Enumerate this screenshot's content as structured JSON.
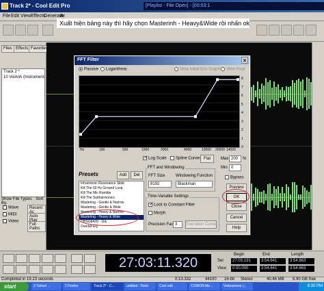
{
  "window": {
    "title": "Track 2* - Cool Edit Pro",
    "title_strip": "[Playlist - File Open] - [00:03:1"
  },
  "menu": [
    "File",
    "Edit",
    "View",
    "Effects",
    "Generate",
    "Ar"
  ],
  "annotation": "Xuất hiện bảng này thì hãy chọn Masterinh - Heavy&Wide rồi nhấn ok",
  "left_panel": {
    "tabs": [
      "Files",
      "Effects",
      "Favorites"
    ],
    "files": [
      "Track 2 *",
      "10 VoiAnh (Instrumental) -"
    ],
    "show_file_types": "Show File Types:",
    "sort_by": "Sort By:",
    "types": [
      "Wave",
      "MIDI",
      "Video"
    ],
    "sort_value": "Recent Ac",
    "auto_play": "Auto Play",
    "full_paths": "Full Paths"
  },
  "fft_dialog": {
    "title": "FFT Filter",
    "mode": {
      "passive": "Passive",
      "logarithmic": "Logarithmic",
      "passive_selected": true
    },
    "view_options": [
      "View Initial Env Graph",
      "View Final"
    ],
    "y_axis": [
      "8",
      "7",
      "6",
      "5",
      "4",
      "3",
      "2",
      "1",
      "0"
    ],
    "x_axis": [
      "Hz",
      "100",
      "500",
      "1000",
      "2000",
      "4000",
      "10000",
      "20000",
      "14000"
    ],
    "log_scale": "Log Scale",
    "log_scale_checked": true,
    "spline_curves": "Spline Curves",
    "spline_checked": false,
    "flat_button": "Flat",
    "max_label": "Max",
    "max_value": "200",
    "max_unit": "%",
    "min_label": "Min",
    "min_value": "0",
    "presets_title": "Presets",
    "add_button": "Add",
    "del_button": "Del",
    "presets": [
      "Inharmonic Resonance Slide",
      "Kill The 60 Hz  Ground Loop",
      "Kill The Mic Rumble",
      "Kill The Subharmonics",
      "Mastering - Gentle & Narrow",
      "Mastering - Gentle & Wide",
      "Mastering - Heavy & Narrow",
      "Mastering - Heavy & Wide",
      "OHSG8420 - 1kk",
      "Overkill EQ"
    ],
    "selected_preset": "Mastering - Heavy & Wide",
    "fft_group": "FFT and Windowing",
    "fft_size_label": "FFT Size",
    "fft_size_value": "8192",
    "windowing_label": "Windowing Function",
    "windowing_value": "Blackman",
    "tv_group": "Time-Variable Settings",
    "lock_label": "Lock to Constant Filter",
    "lock_checked": true,
    "morph_label": "Morph",
    "precision_label": "Precision Factor",
    "precision_value": "3",
    "transition_button": "Transition Curve",
    "bypass_label": "Bypass",
    "preview_button": "Preview",
    "ok_button": "OK",
    "close_button": "Close",
    "cancel_button": "Cancel",
    "help_button": "Help",
    "curve": [
      {
        "x": 0,
        "y": 0.18
      },
      {
        "x": 0.1,
        "y": 0.43
      },
      {
        "x": 0.73,
        "y": 0.43
      },
      {
        "x": 0.87,
        "y": 0.95
      },
      {
        "x": 1.0,
        "y": 0.95
      }
    ]
  },
  "time_display": "27:03:11.320",
  "time_table": {
    "headers": [
      "Begin",
      "End",
      "Length"
    ],
    "rows": [
      {
        "label": "Sel",
        "values": [
          "27:03.131",
          "3:54.641",
          "3:54.663"
        ]
      },
      {
        "label": "View",
        "values": [
          "0:00.000",
          "3:54.641",
          "3:54.663"
        ]
      }
    ]
  },
  "status": {
    "completed": "Completed in 19.23 seconds",
    "rate": "44100",
    "bits": "16-bit",
    "channels": "Stereo",
    "size": "40.46 MB",
    "free": "6.90 GB free",
    "disk": "0:13.332"
  },
  "taskbar": {
    "start": "start",
    "tasks": [
      "3 Yahoo! ...",
      "2 Firefox",
      "Track 2* - C...",
      "untitled - Paint",
      "Cool edit",
      "COWON Me...",
      "Vietnamese (..."
    ],
    "clock": "6:30 PM"
  }
}
